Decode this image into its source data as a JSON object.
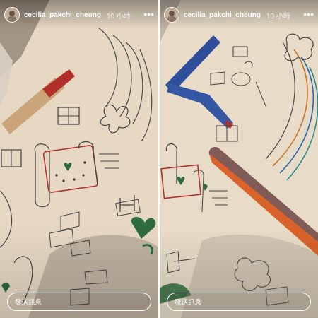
{
  "stories": [
    {
      "username": "cecilia_pakchi_cheung",
      "time": "10 小時",
      "reply_placeholder": "發送訊息"
    },
    {
      "username": "cecilia_pakchi_cheung",
      "time": "10 小時",
      "reply_placeholder": "發送訊息"
    }
  ],
  "icons": {
    "more": "more-options-icon",
    "avatar": "avatar"
  },
  "colors": {
    "paper": "#e7dbc8",
    "pen_red": "#b2302a",
    "marker_blue": "#2f4f9a",
    "marker_orange": "#d9632a",
    "green_heart": "#2f6b3f"
  }
}
